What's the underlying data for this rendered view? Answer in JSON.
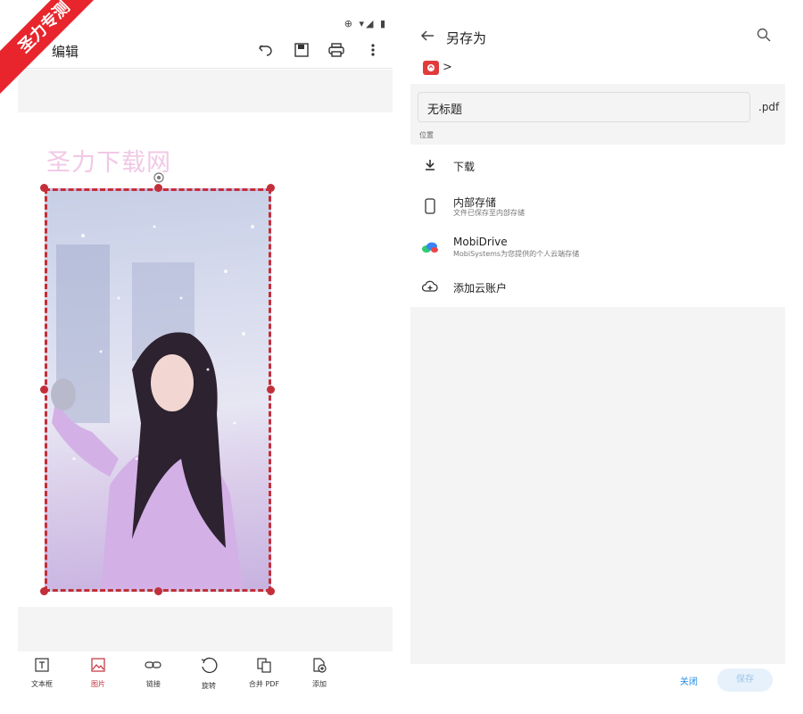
{
  "left": {
    "status_icons": "⊕ ▾◢ ▮",
    "title": "编辑",
    "watermark": "圣力下载网",
    "ribbon_text": "圣力专测",
    "toolbar_icons": [
      "undo-icon",
      "save-icon",
      "print-icon",
      "more-vert-icon"
    ],
    "bottom_tools": [
      {
        "label": "文本框",
        "icon": "textbox-icon",
        "active": false
      },
      {
        "label": "图片",
        "icon": "image-icon",
        "active": true
      },
      {
        "label": "链接",
        "icon": "link-icon",
        "active": false
      },
      {
        "label": "旋转",
        "icon": "rotate-icon",
        "active": false
      },
      {
        "label": "合并 PDF",
        "icon": "merge-pdf-icon",
        "active": false
      },
      {
        "label": "添加",
        "icon": "add-page-icon",
        "active": false
      }
    ]
  },
  "right": {
    "title": "另存为",
    "breadcrumb_sep": ">",
    "filename": "无标题",
    "extension": ".pdf",
    "location_title": "位置",
    "locations": [
      {
        "name": "下载",
        "sub": "",
        "icon": "download-icon"
      },
      {
        "name": "内部存储",
        "sub": "文件已保存至内部存储",
        "icon": "phone-icon"
      },
      {
        "name": "MobiDrive",
        "sub": "MobiSystems为您提供的个人云端存储",
        "icon": "mobidrive-icon"
      },
      {
        "name": "添加云账户",
        "sub": "",
        "icon": "cloud-add-icon"
      }
    ],
    "close_label": "关闭",
    "save_label": "保存"
  },
  "colors": {
    "accent": "#c22f3a",
    "ribbon": "#e8252c",
    "link": "#1e88e5",
    "watermark": "#f1c8e6"
  }
}
